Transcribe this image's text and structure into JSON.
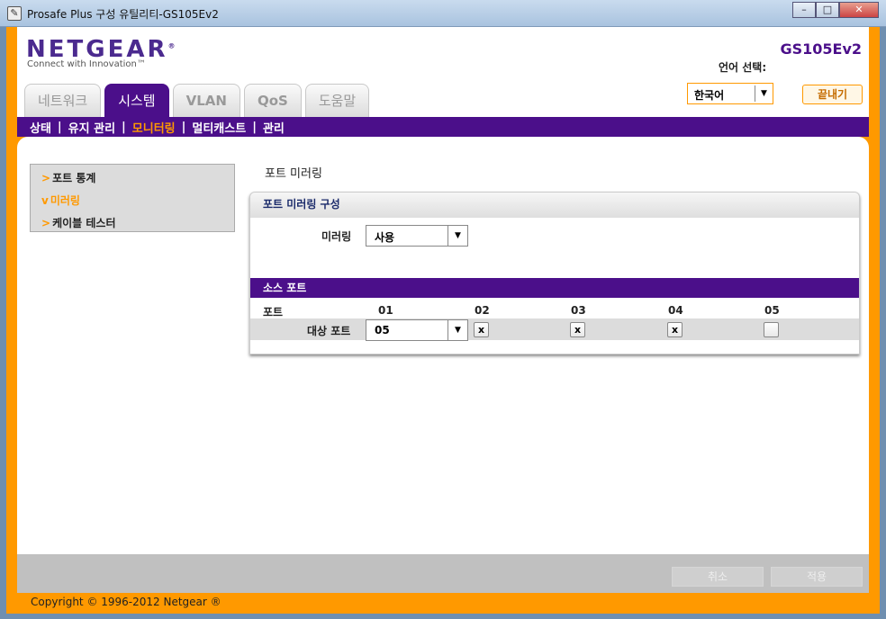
{
  "window": {
    "title": "Prosafe Plus 구성 유틸리티-GS105Ev2",
    "btn_minimize": "–",
    "btn_maximize": "□",
    "btn_close": "✕"
  },
  "header": {
    "logo": "NETGEAR",
    "logo_mark": "®",
    "tagline": "Connect with Innovation™",
    "model": "GS105Ev2",
    "language_label": "언어 선택:",
    "language_value": "한국어",
    "logout_label": "끝내기"
  },
  "tabs": [
    {
      "label": "네트워크"
    },
    {
      "label": "시스템"
    },
    {
      "label": "VLAN"
    },
    {
      "label": "QoS"
    },
    {
      "label": "도움말"
    }
  ],
  "subnav": [
    {
      "label": "상태"
    },
    {
      "label": "유지 관리"
    },
    {
      "label": "모니터링"
    },
    {
      "label": "멀티캐스트"
    },
    {
      "label": "관리"
    }
  ],
  "left_menu": [
    {
      "marker": ">",
      "label": "포트 통계"
    },
    {
      "marker": "v",
      "label": "미러링"
    },
    {
      "marker": ">",
      "label": "케이블 테스터"
    }
  ],
  "page_title": "포트 미러링",
  "panel": {
    "heading": "포트 미러링 구성",
    "mirroring_label": "미러링",
    "mirroring_value": "사용",
    "source_ports_label": "소스 포트",
    "port_column_label": "포트",
    "ports": [
      {
        "number": "01",
        "mark": "x"
      },
      {
        "number": "02",
        "mark": "x"
      },
      {
        "number": "03",
        "mark": "x"
      },
      {
        "number": "04",
        "mark": "x"
      },
      {
        "number": "05",
        "mark": ""
      }
    ],
    "dest_port_label": "대상 포트",
    "dest_port_value": "05"
  },
  "footer": {
    "cancel_label": "취소",
    "apply_label": "적용",
    "copyright": "Copyright © 1996-2012 Netgear ®"
  },
  "colors": {
    "brand_purple": "#4b0f8a",
    "accent_orange": "#ff9900"
  }
}
